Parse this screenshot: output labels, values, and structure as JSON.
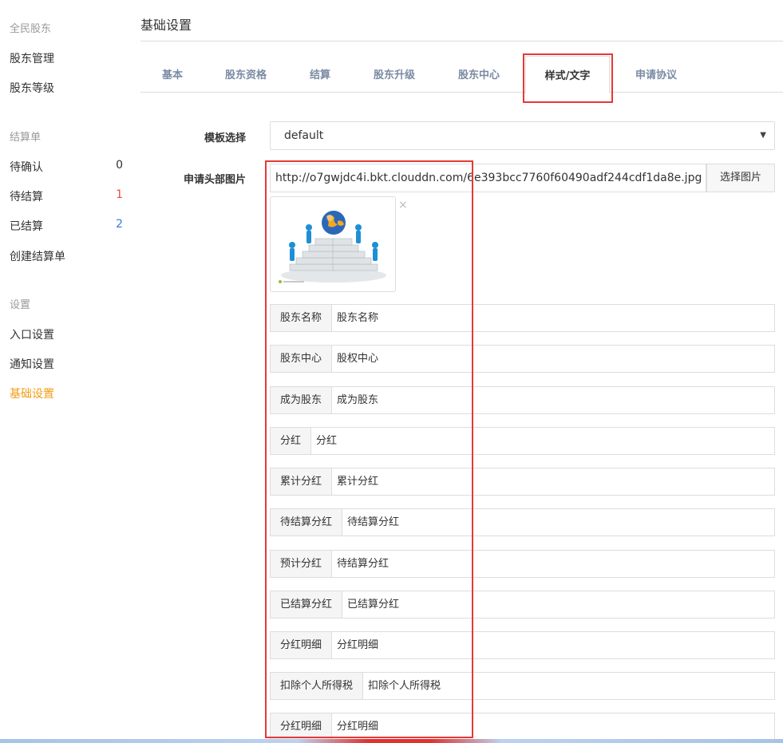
{
  "sidebar": {
    "section1_title": "全民股东",
    "section1_items": [
      {
        "label": "股东管理"
      },
      {
        "label": "股东等级"
      }
    ],
    "section2_title": "结算单",
    "section2_items": [
      {
        "label": "待确认",
        "count": "0"
      },
      {
        "label": "待结算",
        "count": "1"
      },
      {
        "label": "已结算",
        "count": "2"
      },
      {
        "label": "创建结算单"
      }
    ],
    "section3_title": "设置",
    "section3_items": [
      {
        "label": "入口设置"
      },
      {
        "label": "通知设置"
      },
      {
        "label": "基础设置"
      }
    ]
  },
  "page": {
    "title": "基础设置"
  },
  "tabs": [
    {
      "label": "基本"
    },
    {
      "label": "股东资格"
    },
    {
      "label": "结算"
    },
    {
      "label": "股东升级"
    },
    {
      "label": "股东中心"
    },
    {
      "label": "样式/文字"
    },
    {
      "label": "申请协议"
    }
  ],
  "form": {
    "template_label": "模板选择",
    "template_value": "default",
    "header_image_label": "申请头部图片",
    "header_image_url": "http://o7gwjdc4i.bkt.clouddn.com/6e393bcc7760f60490adf244cdf1da8e.jpg",
    "pick_image_button": "选择图片",
    "close_symbol": "×",
    "rows": [
      {
        "addon": "股东名称",
        "value": "股东名称"
      },
      {
        "addon": "股东中心",
        "value": "股权中心"
      },
      {
        "addon": "成为股东",
        "value": "成为股东"
      },
      {
        "addon": "分红",
        "value": "分红"
      },
      {
        "addon": "累计分红",
        "value": "累计分红"
      },
      {
        "addon": "待结算分红",
        "value": "待结算分红"
      },
      {
        "addon": "预计分红",
        "value": "待结算分红"
      },
      {
        "addon": "已结算分红",
        "value": "已结算分红"
      },
      {
        "addon": "分红明细",
        "value": "分红明细"
      },
      {
        "addon": "扣除个人所得税",
        "value": "扣除个人所得税"
      },
      {
        "addon": "分红明细",
        "value": "分红明细"
      }
    ]
  },
  "colors": {
    "accent_orange": "#f39c12",
    "highlight_red": "#e53935",
    "count_red": "#e74c3c",
    "count_blue": "#3a7bd5"
  }
}
